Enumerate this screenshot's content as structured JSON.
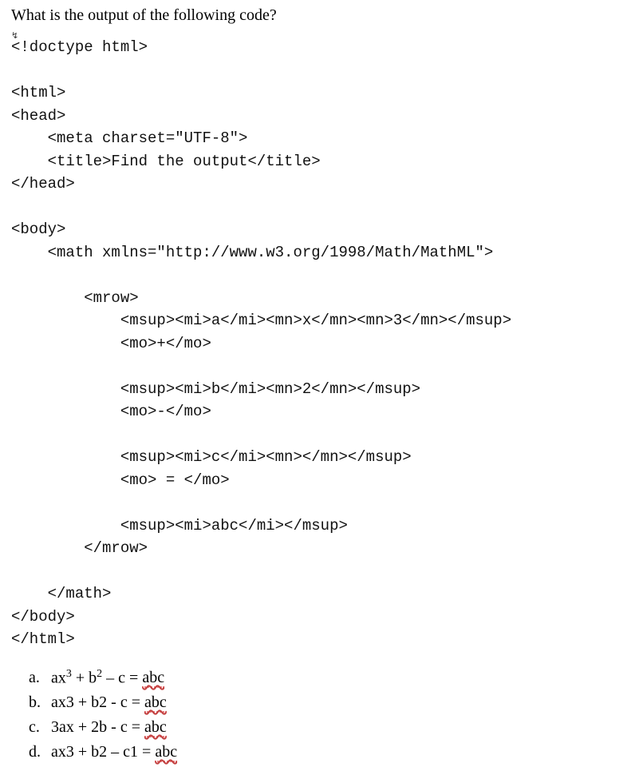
{
  "question": "What is the output of the following code?",
  "arrow_glyph": "↯",
  "code": {
    "l0": "<!doctype html>",
    "l1": "",
    "l2": "<html>",
    "l3": "<head>",
    "l4": "    <meta charset=\"UTF-8\">",
    "l5": "    <title>Find the output</title>",
    "l6": "</head>",
    "l7": "",
    "l8": "<body>",
    "l9": "    <math xmlns=\"http://www.w3.org/1998/Math/MathML\">",
    "l10": "",
    "l11": "        <mrow>",
    "l12": "            <msup><mi>a</mi><mn>x</mn><mn>3</mn></msup>",
    "l13": "            <mo>+</mo>",
    "l14": "",
    "l15": "            <msup><mi>b</mi><mn>2</mn></msup>",
    "l16": "            <mo>-</mo>",
    "l17": "",
    "l18": "            <msup><mi>c</mi><mn></mn></msup>",
    "l19": "            <mo> = </mo>",
    "l20": "",
    "l21": "            <msup><mi>abc</mi></msup>",
    "l22": "        </mrow>",
    "l23": "",
    "l24": "    </math>",
    "l25": "</body>",
    "l26": "</html>"
  },
  "options": {
    "a": {
      "letter": "a.",
      "pre": "ax",
      "sup1": "3",
      "mid1": " + b",
      "sup2": "2",
      "mid2": " – c = ",
      "abc": "abc"
    },
    "b": {
      "letter": "b.",
      "text": "ax3 + b2 - c = ",
      "abc": "abc"
    },
    "c": {
      "letter": "c.",
      "text": "3ax + 2b - c = ",
      "abc": "abc"
    },
    "d": {
      "letter": "d.",
      "text": "ax3 + b2 – c1 = ",
      "abc": "abc"
    }
  }
}
